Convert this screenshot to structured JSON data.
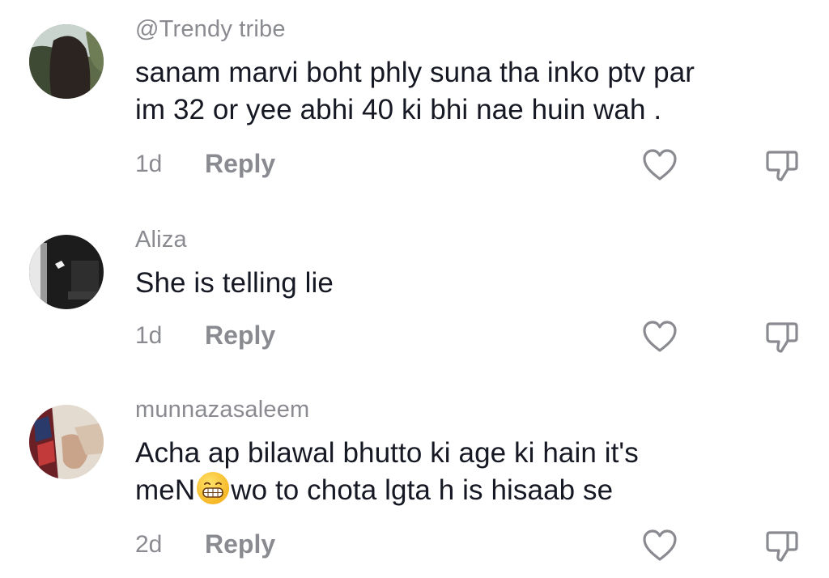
{
  "comments": [
    {
      "username": "@Trendy tribe",
      "lines": [
        "sanam marvi boht phly suna tha inko ptv par",
        "im 32 or yee abhi 40 ki bhi nae huin wah ."
      ],
      "age": "1d",
      "reply_label": "Reply",
      "avatar_colors": [
        "#4d5a3e",
        "#2b2420",
        "#c9d4cf"
      ]
    },
    {
      "username": "Aliza",
      "lines": [
        "She is telling lie"
      ],
      "age": "1d",
      "reply_label": "Reply",
      "avatar_colors": [
        "#1c1c1c",
        "#e8e8e8",
        "#4a4a4a"
      ]
    },
    {
      "username": "munnazasaleem",
      "lines_part": {
        "line1": "Acha ap bilawal bhutto ki age ki hain it's",
        "line2_before": "meN",
        "emoji": "grinning-face",
        "line2_after": "wo to chota lgta h is hisaab se"
      },
      "age": "2d",
      "reply_label": "Reply",
      "avatar_colors": [
        "#d9cfc4",
        "#7a2a2e",
        "#c9a48a"
      ]
    }
  ],
  "colors": {
    "primary_text": "#161823",
    "secondary_text": "#8a8b91",
    "icon": "#8a8b91"
  }
}
